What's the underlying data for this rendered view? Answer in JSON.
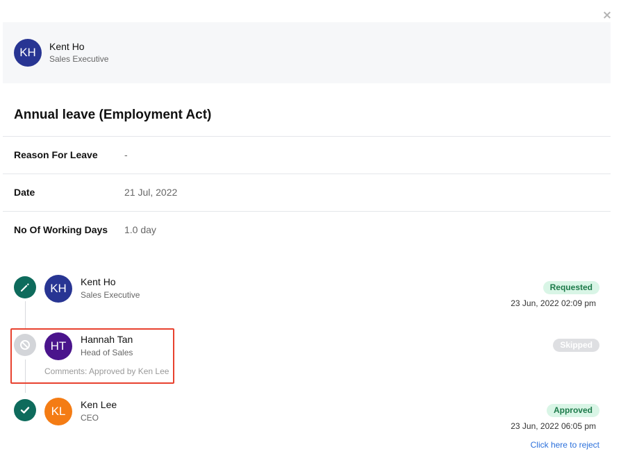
{
  "header": {
    "initials": "KH",
    "name": "Kent Ho",
    "role": "Sales Executive",
    "avatar_color": "#283593"
  },
  "close_icon": "×",
  "leave_type": "Annual leave (Employment Act)",
  "details": [
    {
      "label": "Reason For Leave",
      "value": "-"
    },
    {
      "label": "Date",
      "value": "21 Jul, 2022"
    },
    {
      "label": "No Of Working Days",
      "value": "1.0 day"
    }
  ],
  "timeline": [
    {
      "icon": "pencil-icon",
      "icon_color": "#0e6b5c",
      "initials": "KH",
      "avatar_color": "#283593",
      "name": "Kent Ho",
      "role": "Sales Executive",
      "status": "Requested",
      "timestamp": "23 Jun, 2022 02:09 pm"
    },
    {
      "icon": "ban-icon",
      "icon_color": "#d3d5d9",
      "initials": "HT",
      "avatar_color": "#4a148c",
      "name": "Hannah Tan",
      "role": "Head of Sales",
      "comment": "Comments: Approved by Ken Lee",
      "status": "Skipped"
    },
    {
      "icon": "check-icon",
      "icon_color": "#0e6b5c",
      "initials": "KL",
      "avatar_color": "#f47c14",
      "name": "Ken Lee",
      "role": "CEO",
      "status": "Approved",
      "timestamp": "23 Jun, 2022 06:05 pm",
      "action_link": "Click here to reject"
    }
  ],
  "highlight_color": "#e8412e"
}
